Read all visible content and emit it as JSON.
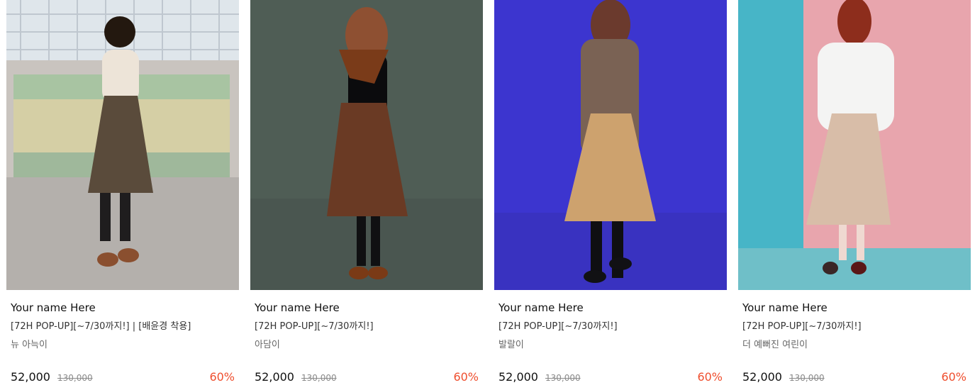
{
  "products": [
    {
      "brand": "Your name Here",
      "title": "[72H POP-UP][~7/30까지!] | [배윤경 착용]",
      "option": "뉴 아늑이",
      "sale_price": "52,000",
      "original_price": "130,000",
      "discount": "60%"
    },
    {
      "brand": "Your name Here",
      "title": "[72H POP-UP][~7/30까지!]",
      "option": "아담이",
      "sale_price": "52,000",
      "original_price": "130,000",
      "discount": "60%"
    },
    {
      "brand": "Your name Here",
      "title": "[72H POP-UP][~7/30까지!]",
      "option": "발랄이",
      "sale_price": "52,000",
      "original_price": "130,000",
      "discount": "60%"
    },
    {
      "brand": "Your name Here",
      "title": "[72H POP-UP][~7/30까지!]",
      "option": "더 예뻐진 여린이",
      "sale_price": "52,000",
      "original_price": "130,000",
      "discount": "60%"
    }
  ],
  "colors": {
    "discount": "#ef4f2f",
    "card1_bg": "#c9c4bf",
    "card2_bg": "#4f5d55",
    "card3_bg": "#3c35cf",
    "card4_bg_left": "#47b5c7",
    "card4_bg_right": "#e8a5ad"
  }
}
